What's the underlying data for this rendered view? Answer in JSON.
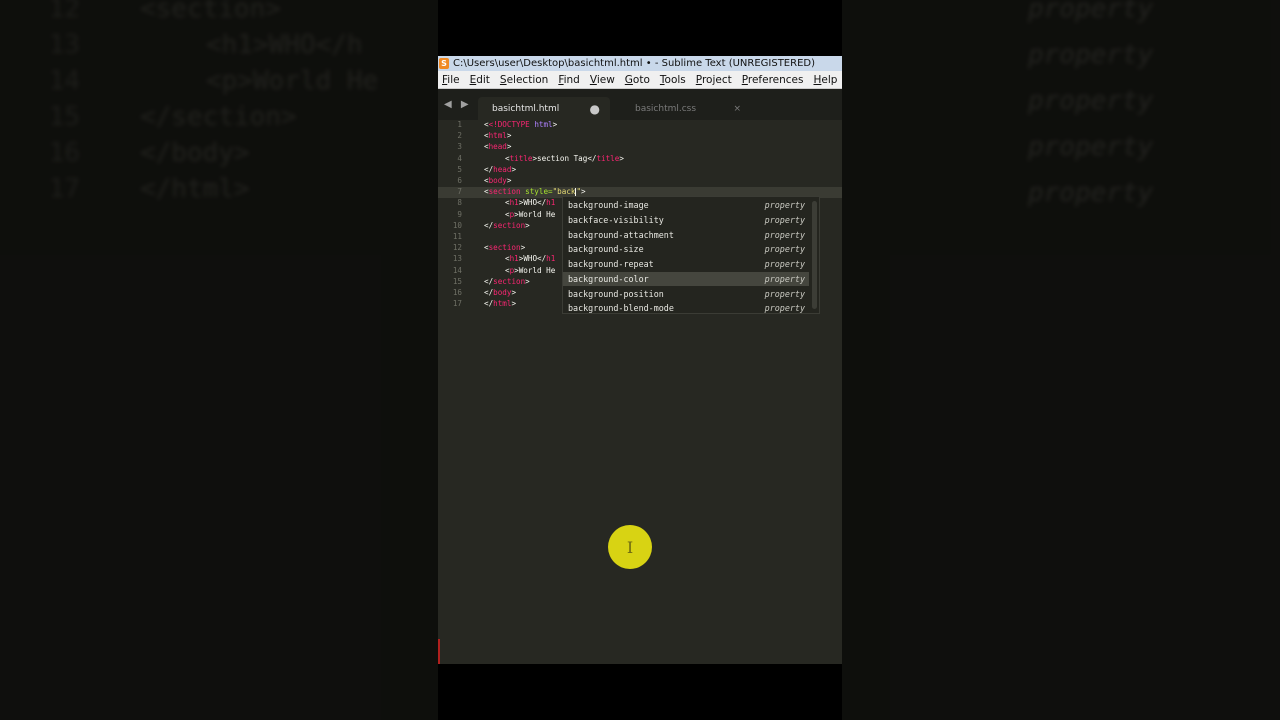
{
  "window_title": "C:\\Users\\user\\Desktop\\basichtml.html • - Sublime Text (UNREGISTERED)",
  "menu": [
    "File",
    "Edit",
    "Selection",
    "Find",
    "View",
    "Goto",
    "Tools",
    "Project",
    "Preferences",
    "Help"
  ],
  "tab_nav": "◀ ▶",
  "tabs": [
    {
      "label": "basichtml.html",
      "active": true,
      "control": "●"
    },
    {
      "label": "basichtml.css",
      "active": false,
      "control": "×"
    }
  ],
  "line_numbers": [
    "1",
    "2",
    "3",
    "4",
    "5",
    "6",
    "7",
    "8",
    "9",
    "10",
    "11",
    "12",
    "13",
    "14",
    "15",
    "16",
    "17"
  ],
  "code": {
    "l1_open": "<!",
    "l1_kw": "DOCTYPE",
    "l1_rest": " html",
    "l1_close": ">",
    "l2": "html",
    "l3": "head",
    "l4_tag": "title",
    "l4_text": "section Tag",
    "l4_end": "title",
    "l5": "head",
    "l6": "body",
    "l7_tag": "section",
    "l7_attr": " style=",
    "l7_val": "\"back",
    "l8_tag": "h1",
    "l8_text": "WHO</",
    "l9_tag": "p",
    "l9_text": "World He",
    "l10": "section",
    "l12": "section",
    "l13_tag": "h1",
    "l13_text": "WHO</",
    "l14_tag": "p",
    "l14_text": "World He",
    "l15": "section",
    "l16": "body",
    "l17": "html"
  },
  "autocomplete": [
    {
      "name": "background-image",
      "kind": "property"
    },
    {
      "name": "backface-visibility",
      "kind": "property"
    },
    {
      "name": "background-attachment",
      "kind": "property"
    },
    {
      "name": "background-size",
      "kind": "property"
    },
    {
      "name": "background-repeat",
      "kind": "property"
    },
    {
      "name": "background-color",
      "kind": "property",
      "selected": true
    },
    {
      "name": "background-position",
      "kind": "property"
    },
    {
      "name": "background-blend-mode",
      "kind": "property"
    }
  ],
  "mouse_cursor_glyph": "I",
  "background_blur": {
    "lines": [
      {
        "num": "12",
        "text": "<section>"
      },
      {
        "num": "13",
        "text": "<h1>WHO</h"
      },
      {
        "num": "14",
        "text": "<p>World He"
      },
      {
        "num": "15",
        "text": "</section>"
      },
      {
        "num": "16",
        "text": "</body>"
      },
      {
        "num": "17",
        "text": "</html>"
      }
    ],
    "props": [
      "property",
      "property",
      "property",
      "property",
      "property"
    ]
  },
  "colors": {
    "editor_bg": "#272822",
    "tag": "#f92672",
    "keyword": "#ae81ff",
    "string": "#e6db74",
    "attr": "#a6e22e",
    "highlight_cursor": "#d8d313"
  }
}
